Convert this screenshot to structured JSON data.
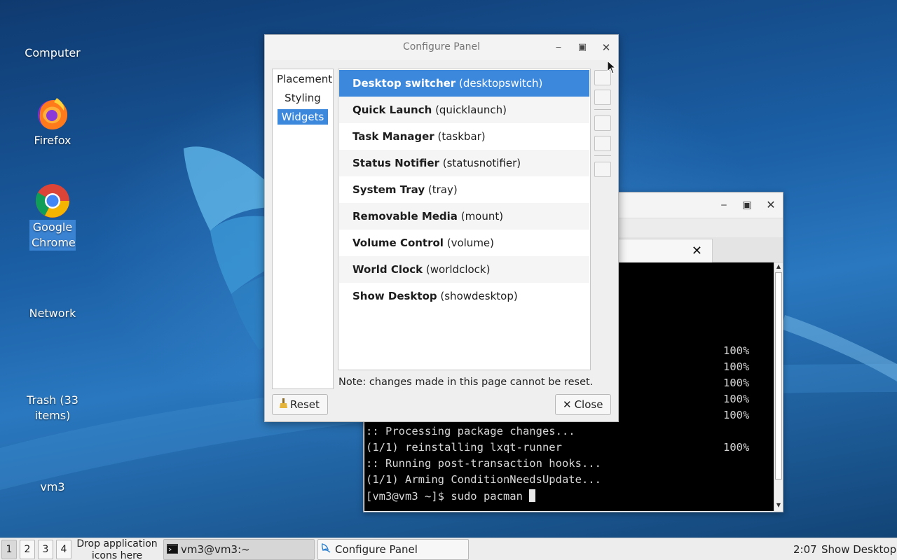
{
  "desktop": {
    "icons": [
      {
        "label": "Computer"
      },
      {
        "label": "Firefox"
      },
      {
        "label": "Google Chrome"
      },
      {
        "label": "Network"
      },
      {
        "label": "Trash (33 items)"
      },
      {
        "label": "vm3"
      }
    ]
  },
  "terminal": {
    "percent_lines": [
      "100%",
      "100%",
      "100%",
      "100%",
      "100%"
    ],
    "lines": [
      ":: Processing package changes...",
      "(1/1) reinstalling lxqt-runner",
      ":: Running post-transaction hooks...",
      "(1/1) Arming ConditionNeedsUpdate...",
      "[vm3@vm3 ~]$ sudo pacman "
    ],
    "reinstall_percent": "100%",
    "tab_close": "✕"
  },
  "dialog": {
    "title": "Configure Panel",
    "sections": [
      {
        "label": "Placement"
      },
      {
        "label": "Styling"
      },
      {
        "label": "Widgets"
      }
    ],
    "widgets": [
      {
        "name": "Desktop switcher",
        "id": "(desktopswitch)"
      },
      {
        "name": "Quick Launch",
        "id": "(quicklaunch)"
      },
      {
        "name": "Task Manager",
        "id": "(taskbar)"
      },
      {
        "name": "Status Notifier",
        "id": "(statusnotifier)"
      },
      {
        "name": "System Tray",
        "id": "(tray)"
      },
      {
        "name": "Removable Media",
        "id": "(mount)"
      },
      {
        "name": "Volume Control",
        "id": "(volume)"
      },
      {
        "name": "World Clock",
        "id": "(worldclock)"
      },
      {
        "name": "Show Desktop",
        "id": "(showdesktop)"
      }
    ],
    "note": "Note: changes made in this page cannot be reset.",
    "reset_label": "Reset",
    "close_label": "Close"
  },
  "taskbar": {
    "workspaces": [
      "1",
      "2",
      "3",
      "4"
    ],
    "drop_hint": "Drop application icons here",
    "tasks": [
      {
        "label": "vm3@vm3:~"
      },
      {
        "label": "Configure Panel"
      }
    ],
    "clock": "2:07",
    "show_desktop": "Show Desktop"
  },
  "colors": {
    "selection": "#3c88dd",
    "wallpaper": "#1b5fa5"
  }
}
